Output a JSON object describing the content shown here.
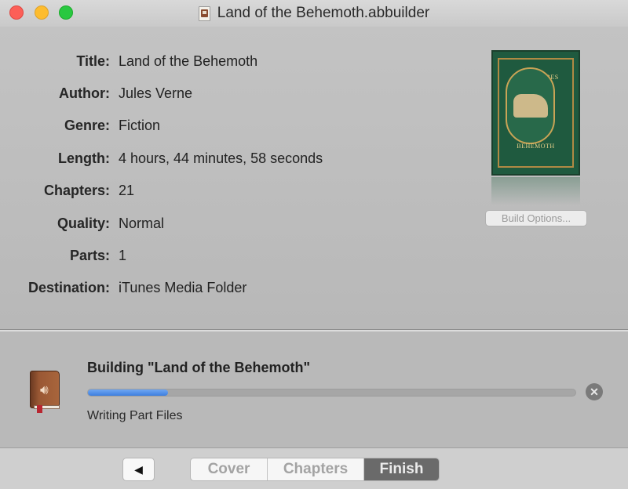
{
  "window": {
    "title": "Land of the Behemoth.abbuilder"
  },
  "info": {
    "rows": [
      {
        "label": "Title:",
        "value": "Land of the Behemoth"
      },
      {
        "label": "Author:",
        "value": "Jules Verne"
      },
      {
        "label": "Genre:",
        "value": "Fiction"
      },
      {
        "label": "Length:",
        "value": "4 hours, 44 minutes, 58 seconds"
      },
      {
        "label": "Chapters:",
        "value": "21"
      },
      {
        "label": "Quality:",
        "value": "Normal"
      },
      {
        "label": "Parts:",
        "value": "1"
      },
      {
        "label": "Destination:",
        "value": "iTunes Media Folder"
      }
    ],
    "cover": {
      "line1": "ADVENTURES",
      "line2": "LAND",
      "line3": "BEHEMOTH"
    },
    "build_options_label": "Build Options..."
  },
  "progress": {
    "heading": "Building \"Land of the Behemoth\"",
    "status": "Writing Part Files",
    "fraction": 0.165,
    "accent_color": "#3d7fdf"
  },
  "nav": {
    "back_label": "◀",
    "steps": [
      {
        "label": "Cover",
        "active": false
      },
      {
        "label": "Chapters",
        "active": false
      },
      {
        "label": "Finish",
        "active": true
      }
    ]
  }
}
